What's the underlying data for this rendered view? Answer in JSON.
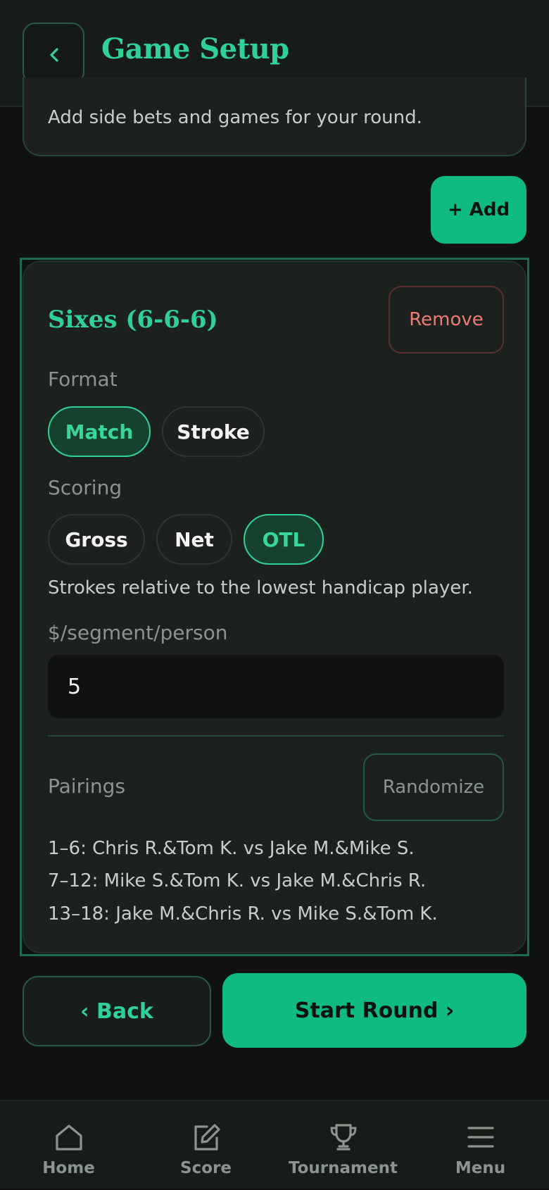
{
  "header": {
    "title": "Game Setup",
    "back_icon": "chevron-left-icon"
  },
  "intro": {
    "text": "Add side bets and games for your round."
  },
  "add_button": "+ Add",
  "game": {
    "title": "Sixes (6-6-6)",
    "remove_label": "Remove",
    "format_label": "Format",
    "format_options": [
      "Match",
      "Stroke"
    ],
    "format_selected": "Match",
    "scoring_label": "Scoring",
    "scoring_options": [
      "Gross",
      "Net",
      "OTL"
    ],
    "scoring_selected": "OTL",
    "scoring_help": "Strokes relative to the lowest handicap player.",
    "amount_label": "$/segment/person",
    "amount_value": "5",
    "pairings_label": "Pairings",
    "randomize_label": "Randomize",
    "pairings": [
      "1–6: Chris R.&Tom K. vs Jake M.&Mike S.",
      "7–12: Mike S.&Tom K. vs Jake M.&Chris R.",
      "13–18: Jake M.&Chris R. vs Mike S.&Tom K."
    ]
  },
  "footer": {
    "back_label": "‹ Back",
    "start_label": "Start Round ›"
  },
  "tabs": [
    {
      "label": "Home",
      "icon": "home-icon"
    },
    {
      "label": "Score",
      "icon": "edit-icon"
    },
    {
      "label": "Tournament",
      "icon": "trophy-icon"
    },
    {
      "label": "Menu",
      "icon": "menu-icon"
    }
  ],
  "colors": {
    "accent": "#10ba83",
    "accent_text": "#2fd197",
    "danger": "#f07a76",
    "background": "#0f1210",
    "card": "#1c211e"
  }
}
